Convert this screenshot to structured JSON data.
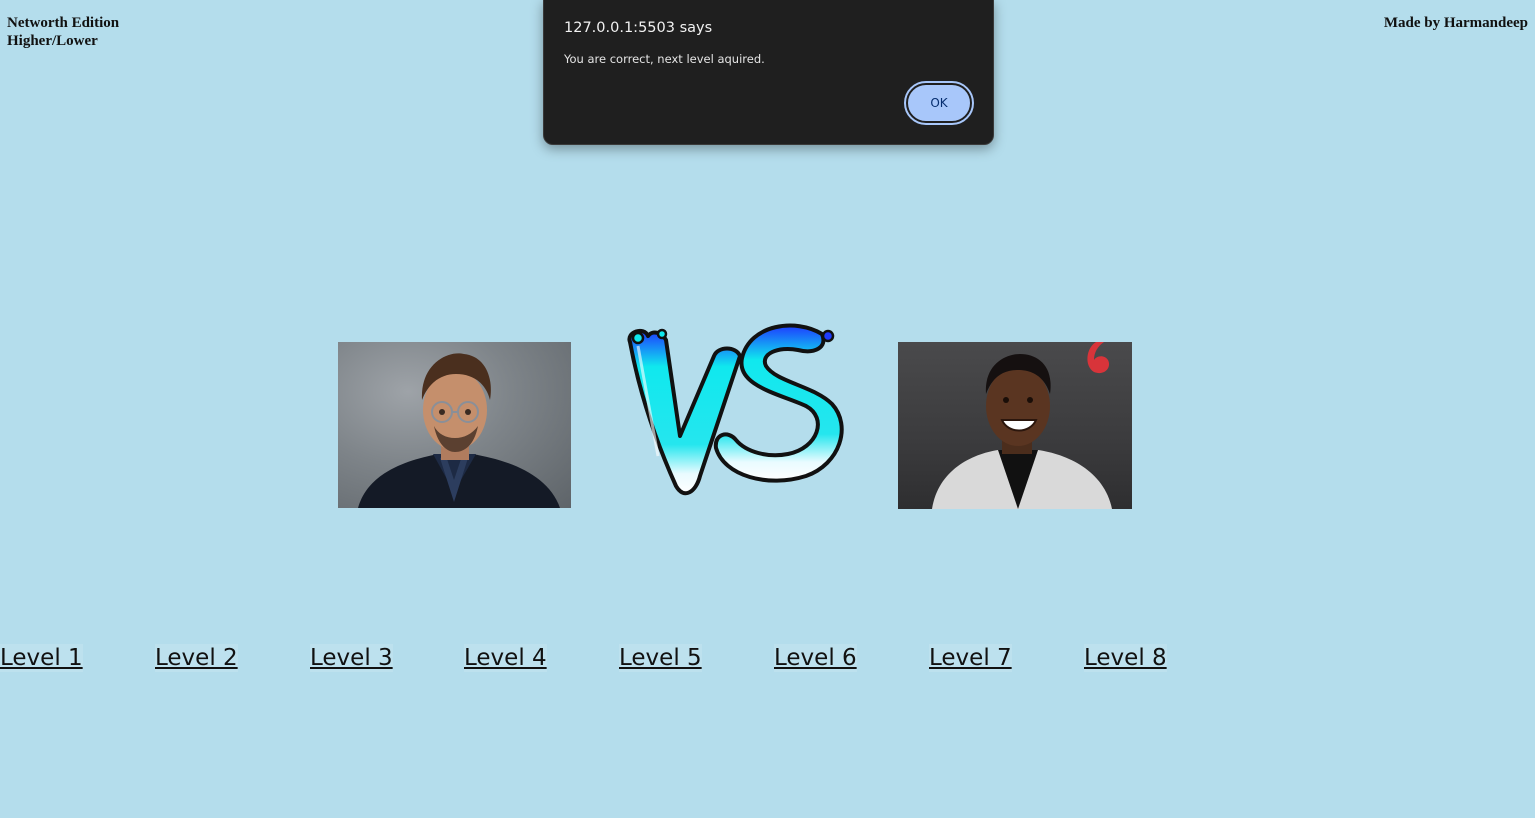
{
  "header": {
    "title_line1": "Networth Edition",
    "title_line2": "Higher/Lower",
    "credit": "Made by Harmandeep"
  },
  "dialog": {
    "title": "127.0.0.1:5503 says",
    "message": "You are correct, next level aquired.",
    "ok_label": "OK"
  },
  "game": {
    "left_image_icon": "celebrity-portrait-man-glasses",
    "right_image_icon": "celebrity-portrait-man-smiling",
    "vs_icon": "vs-graphic"
  },
  "levels": [
    "Level 1",
    "Level 2",
    "Level 3",
    "Level 4",
    "Level 5",
    "Level 6",
    "Level 7",
    "Level 8"
  ],
  "colors": {
    "background": "#b4ddec",
    "dialog_bg": "#1f1f1f",
    "ok_button": "#a8c7fa",
    "vs_fill_top": "#1e3cff",
    "vs_fill_mid": "#10e8ee"
  }
}
